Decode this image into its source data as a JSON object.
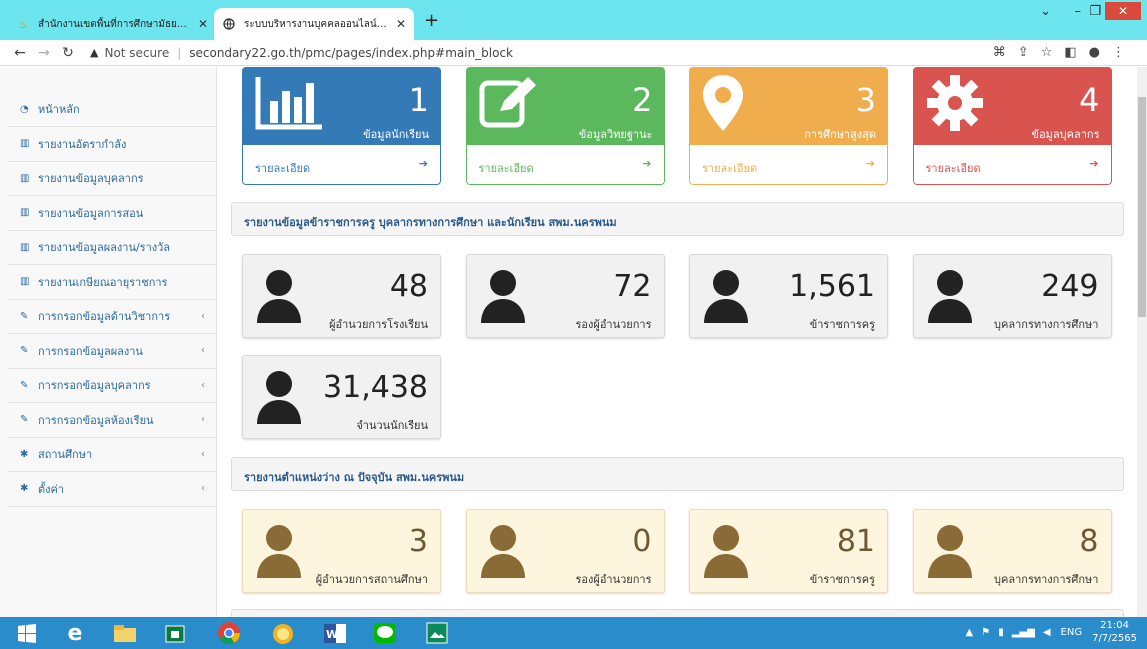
{
  "browser": {
    "tabs": [
      {
        "title": "สำนักงานเขตพื้นที่การศึกษามัธยมศึกษ",
        "active": false
      },
      {
        "title": "ระบบบริหารงานบุคคลออนไลน์ สพม.นค",
        "active": true
      }
    ],
    "security_label": "Not secure",
    "url": "secondary22.go.th/pmc/pages/index.php#main_block"
  },
  "sidebar": {
    "items": [
      {
        "icon": "dashboard-icon",
        "label": "หน้าหลัก",
        "has_submenu": false
      },
      {
        "icon": "bar-chart-icon",
        "label": "รายงานอัตรากำลัง",
        "has_submenu": false
      },
      {
        "icon": "bar-chart-icon",
        "label": "รายงานข้อมูลบุคลากร",
        "has_submenu": false
      },
      {
        "icon": "bar-chart-icon",
        "label": "รายงานข้อมูลการสอน",
        "has_submenu": false
      },
      {
        "icon": "bar-chart-icon",
        "label": "รายงานข้อมูลผลงาน/รางวัล",
        "has_submenu": false
      },
      {
        "icon": "bar-chart-icon",
        "label": "รายงานเกษียณอายุราชการ",
        "has_submenu": false
      },
      {
        "icon": "edit-icon",
        "label": "การกรอกข้อมูลด้านวิชาการ",
        "has_submenu": true
      },
      {
        "icon": "edit-icon",
        "label": "การกรอกข้อมูลผลงาน",
        "has_submenu": true
      },
      {
        "icon": "edit-icon",
        "label": "การกรอกข้อมูลบุคลากร",
        "has_submenu": true
      },
      {
        "icon": "edit-icon",
        "label": "การกรอกข้อมูลห้องเรียน",
        "has_submenu": true
      },
      {
        "icon": "gear-icon",
        "label": "สถานศึกษา",
        "has_submenu": true
      },
      {
        "icon": "gear-icon",
        "label": "ตั้งค่า",
        "has_submenu": true
      }
    ]
  },
  "top_cards": [
    {
      "number": "1",
      "label": "ข้อมูลนักเรียน",
      "details": "รายละเอียด",
      "color": "#337ab7",
      "icon": "bar-chart-icon"
    },
    {
      "number": "2",
      "label": "ข้อมูลวิทยฐานะ",
      "details": "รายละเอียด",
      "color": "#5cb85c",
      "icon": "edit-icon"
    },
    {
      "number": "3",
      "label": "การศึกษาสูงสุด",
      "details": "รายละเอียด",
      "color": "#f0ad4e",
      "icon": "map-marker-icon"
    },
    {
      "number": "4",
      "label": "ข้อมูลบุคลากร",
      "details": "รายละเอียด",
      "color": "#d9534f",
      "icon": "gear-icon"
    }
  ],
  "section1": {
    "title": "รายงานข้อมูลข้าราชการครู บุคลากรทางการศึกษา และนักเรียน สพม.นครพนม",
    "stats": [
      {
        "value": "48",
        "caption": "ผู้อำนวยการโรงเรียน"
      },
      {
        "value": "72",
        "caption": "รองผู้อำนวยการ"
      },
      {
        "value": "1,561",
        "caption": "ข้าราชการครู"
      },
      {
        "value": "249",
        "caption": "บุคลากรทางการศึกษา"
      },
      {
        "value": "31,438",
        "caption": "จำนวนนักเรียน"
      }
    ]
  },
  "section2": {
    "title": "รายงานตำแหน่งว่าง ณ ปัจจุบัน สพม.นครพนม",
    "stats": [
      {
        "value": "3",
        "caption": "ผู้อำนวยการสถานศึกษา"
      },
      {
        "value": "0",
        "caption": "รองผู้อำนวยการ"
      },
      {
        "value": "81",
        "caption": "ข้าราชการครู"
      },
      {
        "value": "8",
        "caption": "บุคลากรทางการศึกษา"
      }
    ]
  },
  "taskbar": {
    "language": "ENG",
    "time": "21:04",
    "date": "7/7/2565"
  }
}
